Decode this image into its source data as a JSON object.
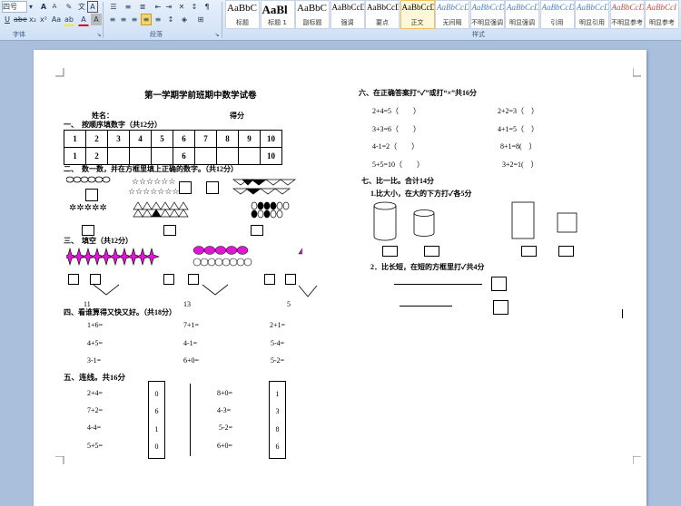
{
  "ribbon": {
    "font_name": "四号",
    "font_group_label": "字体",
    "paragraph_group_label": "段落",
    "styles_group_label": "样式",
    "styles": [
      {
        "sample": "AaBbC",
        "name": "标题"
      },
      {
        "sample": "AaBl",
        "name": "标题 1"
      },
      {
        "sample": "AaBbC",
        "name": "副标题"
      },
      {
        "sample": "AaBbCcD",
        "name": "强调"
      },
      {
        "sample": "AaBbCcD",
        "name": "要点"
      },
      {
        "sample": "AaBbCcDd",
        "name": "正文"
      },
      {
        "sample": "AaBbCcDd",
        "name": "无间隔"
      },
      {
        "sample": "AaBbCcDd",
        "name": "不明显强调"
      },
      {
        "sample": "AaBbCcDd",
        "name": "明显强调"
      },
      {
        "sample": "AaBbCcDd",
        "name": "引用"
      },
      {
        "sample": "AaBbCcDd",
        "name": "明显引用"
      },
      {
        "sample": "AaBbCcDd",
        "name": "不明显参考"
      },
      {
        "sample": "AaBbCcI",
        "name": "明显参考"
      }
    ]
  },
  "doc": {
    "title": "第一学期学前班期中数学试卷",
    "name_label": "姓名：",
    "score_label": "得分",
    "s1": "一、　按顺序填数字（共12分）",
    "table_row1": [
      "1",
      "2",
      "3",
      "4",
      "5",
      "6",
      "7",
      "8",
      "9",
      "10"
    ],
    "table_row2": [
      "1",
      "2",
      "",
      "",
      "",
      "6",
      "",
      "",
      "",
      "10"
    ],
    "s2": "二、　数一数，并在方框里填上正确的数字。（共12分）",
    "s3": "三、　填空（共12分）",
    "s3_numbers": [
      "11",
      "13",
      "5"
    ],
    "s4": "四、看谁算得又快又好。（共18分）",
    "s4_rows": [
      [
        "1+6=",
        "7+1=",
        "2+1="
      ],
      [
        "4+5=",
        "4-1=",
        "5-4="
      ],
      [
        "3-1=",
        "6+0=",
        "5-2="
      ]
    ],
    "s5": "五、连线。共16分",
    "s5_left": [
      "2+4=",
      "7+2=",
      "4-4=",
      "5+5="
    ],
    "s5_box1": [
      "0",
      "6",
      "1",
      "0"
    ],
    "s5_mid": [
      "8+0=",
      "4-3=",
      "5-2=",
      "6+0="
    ],
    "s5_box2": [
      "1",
      "3",
      "8",
      "6"
    ],
    "s6": "六、在正确答案打“✓”或打“×”共16分",
    "s6_rows": [
      [
        "2+4=5（　　）",
        "2+2=3（　）"
      ],
      [
        "3+3=6（　　）",
        "4+1=5（　）"
      ],
      [
        "4-1=2（　　）",
        "8+1=8(　）"
      ],
      [
        "5+5=10（　　）",
        "3+2=1(　）"
      ]
    ],
    "s7": "七、比一比。合计14分",
    "s7_1": "1.比大小，在大的下方打✓各5分",
    "s7_2": "2．比长短，在短的方框里打✓共4分"
  }
}
